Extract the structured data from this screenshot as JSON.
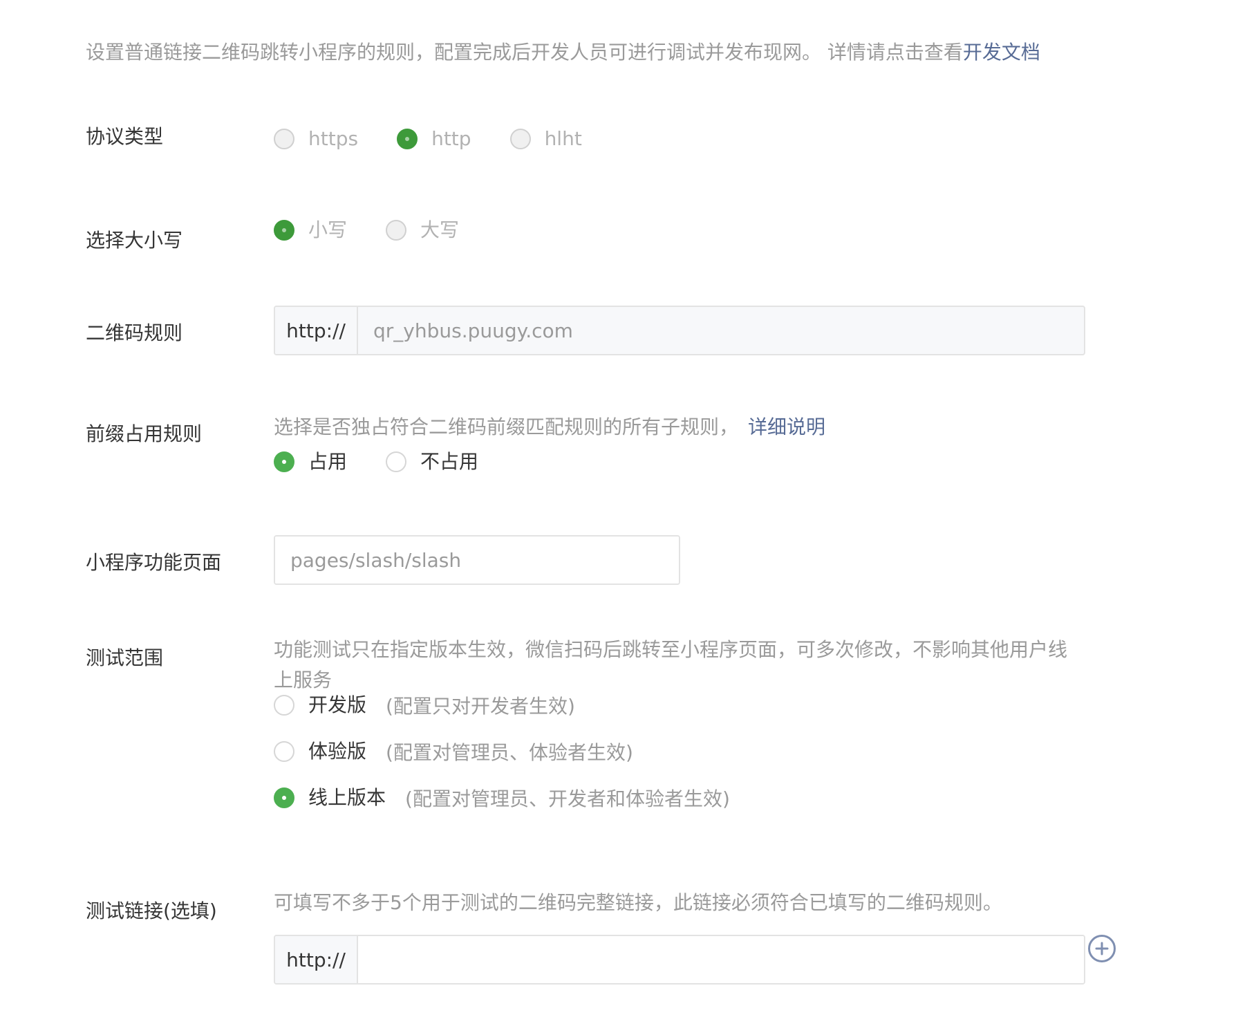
{
  "intro": {
    "text": "设置普通链接二维码跳转小程序的规则，配置完成后开发人员可进行调试并发布现网。 详情请点击查看",
    "link": "开发文档"
  },
  "protocol": {
    "label": "协议类型",
    "options": [
      {
        "label": "https",
        "checked": false
      },
      {
        "label": "http",
        "checked": true
      },
      {
        "label": "hlht",
        "checked": false
      }
    ]
  },
  "case": {
    "label": "选择大小写",
    "options": [
      {
        "label": "小写",
        "checked": true
      },
      {
        "label": "大写",
        "checked": false
      }
    ]
  },
  "qr_rule": {
    "label": "二维码规则",
    "prefix": "http://",
    "value": "qr_yhbus.puugy.com"
  },
  "prefix_rule": {
    "label": "前缀占用规则",
    "hint": "选择是否独占符合二维码前缀匹配规则的所有子规则，",
    "link": "详细说明",
    "options": [
      {
        "label": "占用",
        "checked": true
      },
      {
        "label": "不占用",
        "checked": false
      }
    ]
  },
  "page": {
    "label": "小程序功能页面",
    "value": "pages/slash/slash"
  },
  "test_scope": {
    "label": "测试范围",
    "hint_line1": "功能测试只在指定版本生效，微信扫码后跳转至小程序页面，可多次修改，不影响其他用户线",
    "hint_line2": "上服务",
    "options": [
      {
        "label": "开发版",
        "desc": "(配置只对开发者生效)",
        "checked": false
      },
      {
        "label": "体验版",
        "desc": "(配置对管理员、体验者生效)",
        "checked": false
      },
      {
        "label": "线上版本",
        "desc": "(配置对管理员、开发者和体验者生效)",
        "checked": true
      }
    ]
  },
  "test_link": {
    "label": "测试链接(选填)",
    "hint": "可填写不多于5个用于测试的二维码完整链接，此链接必须符合已填写的二维码规则。",
    "prefix": "http://",
    "value": "",
    "add_icon": "plus-circle-icon"
  },
  "colors": {
    "accent_green": "#4caf50",
    "link_blue": "#576b95"
  }
}
